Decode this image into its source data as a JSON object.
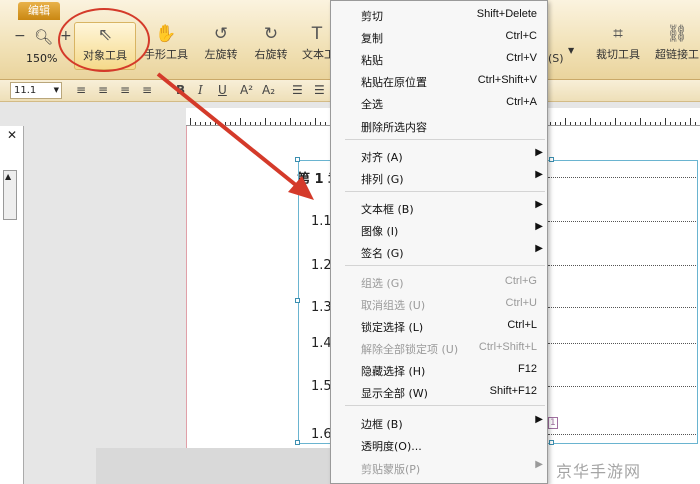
{
  "ribbon": {
    "tab_label": "编辑",
    "zoom_value": "150%",
    "tools": [
      {
        "label": "对象工具",
        "icon": "cursor-arrow-icon"
      },
      {
        "label": "手形工具",
        "icon": "hand-icon"
      },
      {
        "label": "左旋转",
        "icon": "rotate-left-icon"
      },
      {
        "label": "右旋转",
        "icon": "rotate-right-icon"
      },
      {
        "label": "文本工",
        "icon": "text-tool-icon"
      },
      {
        "label": "裁切工具",
        "icon": "crop-icon"
      },
      {
        "label": "超链接工",
        "icon": "link-icon"
      }
    ],
    "s_suffix": "(S)"
  },
  "formatbar": {
    "font_size": "11.1"
  },
  "document": {
    "chapter_heading": "第 1 章",
    "sections": [
      "1.1",
      "1.2",
      "1.3",
      "1.4",
      "1.5",
      "1.6"
    ],
    "page_tag": "1"
  },
  "context_menu": {
    "items": [
      {
        "label": "剪切",
        "key": "Shift+Delete"
      },
      {
        "label": "复制",
        "key": "Ctrl+C"
      },
      {
        "label": "粘贴",
        "key": "Ctrl+V"
      },
      {
        "label": "粘贴在原位置",
        "key": "Ctrl+Shift+V"
      },
      {
        "label": "全选",
        "key": "Ctrl+A"
      },
      {
        "label": "删除所选内容",
        "key": ""
      },
      {
        "label": "对齐 (A)",
        "key": ""
      },
      {
        "label": "排列 (G)",
        "key": ""
      },
      {
        "label": "文本框 (B)",
        "key": ""
      },
      {
        "label": "图像 (I)",
        "key": ""
      },
      {
        "label": "签名 (G)",
        "key": ""
      },
      {
        "label": "组选 (G)",
        "key": "Ctrl+G"
      },
      {
        "label": "取消组选 (U)",
        "key": "Ctrl+U"
      },
      {
        "label": "锁定选择 (L)",
        "key": "Ctrl+L"
      },
      {
        "label": "解除全部锁定项 (U)",
        "key": "Ctrl+Shift+L"
      },
      {
        "label": "隐藏选择 (H)",
        "key": "F12"
      },
      {
        "label": "显示全部 (W)",
        "key": "Shift+F12"
      },
      {
        "label": "边框 (B)",
        "key": ""
      },
      {
        "label": "透明度(O)...",
        "key": ""
      },
      {
        "label": "剪贴蒙版(P)",
        "key": ""
      }
    ]
  },
  "watermark": "京华手游网",
  "colors": {
    "annotation_red": "#d43a2a",
    "ribbon_bg": "#f1e1b6",
    "selection_frame": "#6ab4d0"
  }
}
